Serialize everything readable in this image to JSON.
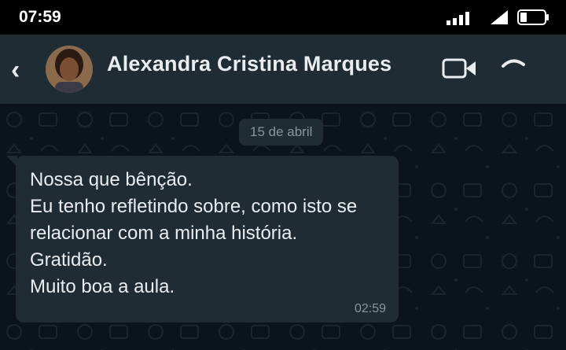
{
  "status_bar": {
    "time": "07:59",
    "icons": [
      "signal-icon",
      "wifi-icon",
      "battery-icon"
    ]
  },
  "header": {
    "back_icon": "‹",
    "contact_name": "Alexandra Cristina Marques",
    "icons": [
      "back-icon",
      "avatar",
      "video-call-icon",
      "voice-call-icon"
    ]
  },
  "chat": {
    "date_label": "15 de abril",
    "message": {
      "lines": [
        "Nossa que bênção.",
        "Eu tenho refletindo sobre, como isto se",
        "relacionar com a minha história.",
        "Gratidão.",
        "Muito boa a aula."
      ],
      "time": "02:59"
    }
  },
  "colors": {
    "header_bg": "#1f2c34",
    "chat_bg": "#0b141a",
    "bubble_bg": "#1f2c34",
    "text_primary": "#e9edef",
    "text_secondary": "#8696a0"
  }
}
